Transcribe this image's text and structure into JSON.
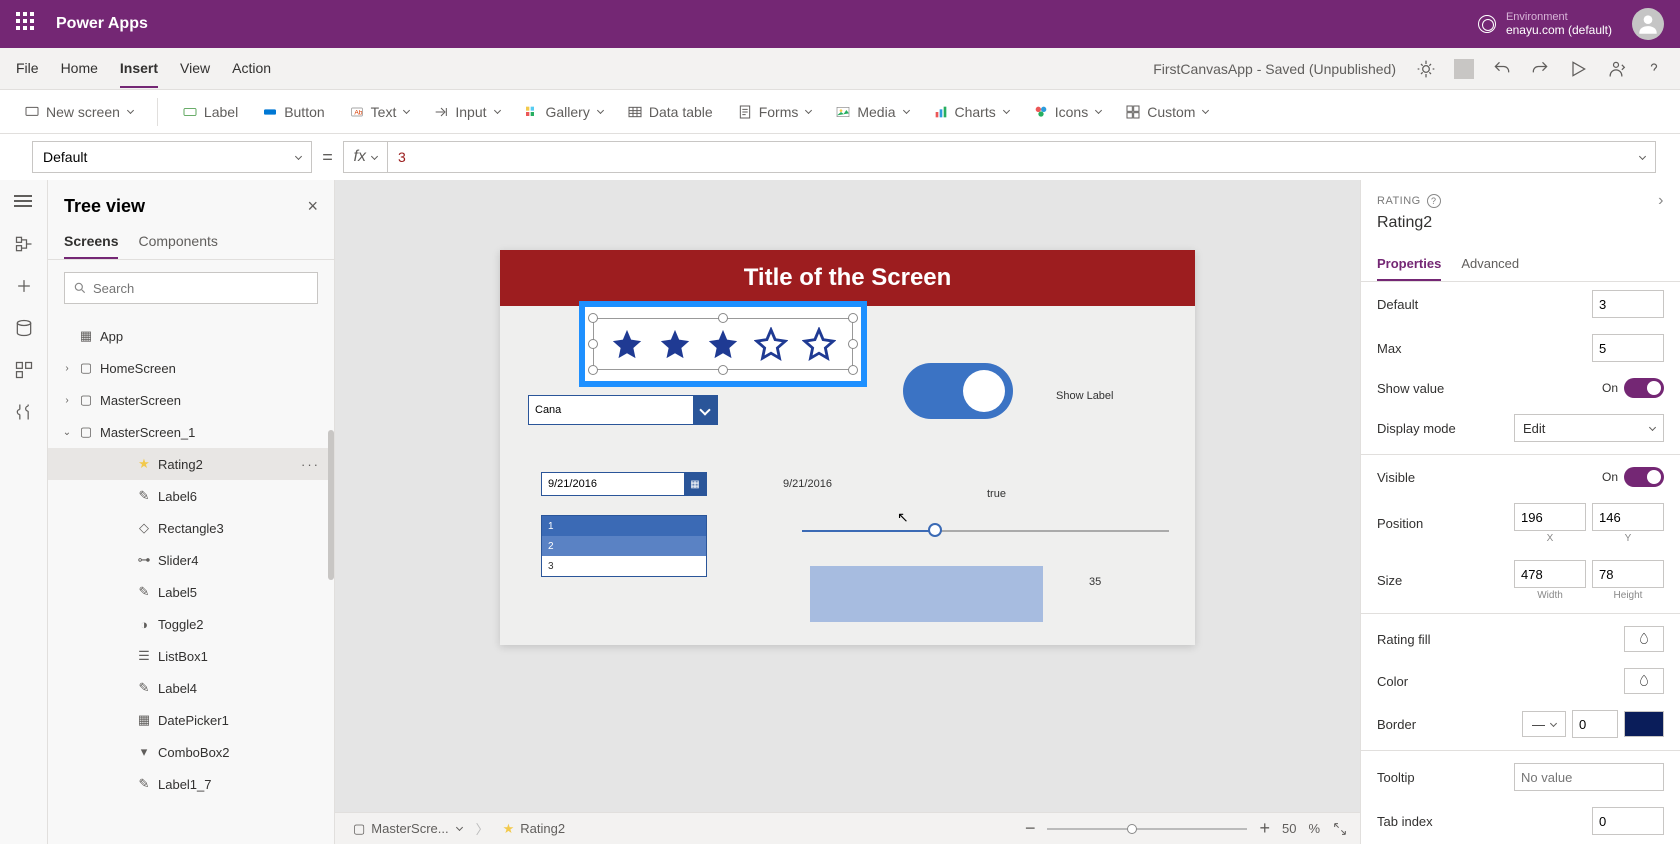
{
  "brand": "Power Apps",
  "environment": {
    "label": "Environment",
    "value": "enayu.com (default)"
  },
  "menubar": {
    "items": [
      "File",
      "Home",
      "Insert",
      "View",
      "Action"
    ],
    "active": "Insert",
    "saveStatus": "FirstCanvasApp - Saved (Unpublished)"
  },
  "ribbon": {
    "newScreen": "New screen",
    "label": "Label",
    "button": "Button",
    "text": "Text",
    "input": "Input",
    "gallery": "Gallery",
    "dataTable": "Data table",
    "forms": "Forms",
    "media": "Media",
    "charts": "Charts",
    "icons": "Icons",
    "custom": "Custom"
  },
  "formula": {
    "property": "Default",
    "value": "3"
  },
  "tree": {
    "title": "Tree view",
    "tabs": {
      "screens": "Screens",
      "components": "Components",
      "active": "Screens"
    },
    "searchPlaceholder": "Search",
    "nodes": {
      "app": "App",
      "home": "HomeScreen",
      "master": "MasterScreen",
      "master1": "MasterScreen_1",
      "rating2": "Rating2",
      "label6": "Label6",
      "rect3": "Rectangle3",
      "slider4": "Slider4",
      "label5": "Label5",
      "toggle2": "Toggle2",
      "listbox1": "ListBox1",
      "label4": "Label4",
      "datepicker1": "DatePicker1",
      "combobox2": "ComboBox2",
      "label17": "Label1_7"
    }
  },
  "canvas": {
    "title": "Title of the Screen",
    "combo": "Cana",
    "showLabel": "Show Label",
    "date": "9/21/2016",
    "dateLabel": "9/21/2016",
    "list": [
      "1",
      "2",
      "3"
    ],
    "trueLabel": "true",
    "sliderVal": "35"
  },
  "statusbar": {
    "screen": "MasterScre...",
    "sel": "Rating2",
    "zoom": "50",
    "unit": "%"
  },
  "props": {
    "type": "RATING",
    "name": "Rating2",
    "tabs": {
      "properties": "Properties",
      "advanced": "Advanced"
    },
    "default": {
      "label": "Default",
      "value": "3"
    },
    "max": {
      "label": "Max",
      "value": "5"
    },
    "showValue": {
      "label": "Show value",
      "state": "On"
    },
    "displayMode": {
      "label": "Display mode",
      "value": "Edit"
    },
    "visible": {
      "label": "Visible",
      "state": "On"
    },
    "position": {
      "label": "Position",
      "x": "196",
      "y": "146",
      "xl": "X",
      "yl": "Y"
    },
    "size": {
      "label": "Size",
      "w": "478",
      "h": "78",
      "wl": "Width",
      "hl": "Height"
    },
    "ratingFill": {
      "label": "Rating fill"
    },
    "color": {
      "label": "Color"
    },
    "border": {
      "label": "Border",
      "val": "0"
    },
    "tooltip": {
      "label": "Tooltip",
      "ph": "No value"
    },
    "tabIndex": {
      "label": "Tab index",
      "value": "0"
    }
  }
}
